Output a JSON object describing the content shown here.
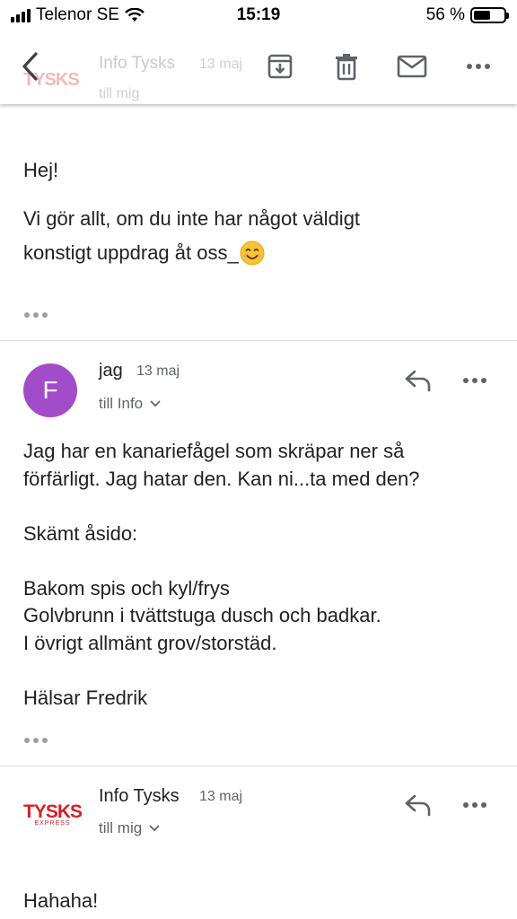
{
  "status_bar": {
    "carrier": "Telenor SE",
    "time": "15:19",
    "battery": "56 %",
    "battery_level": 0.56
  },
  "toolbar": {
    "ghost_sender": "Info Tysks",
    "ghost_date": "13 maj",
    "ghost_recipient": "till mig",
    "ghost_logo": "TYSKS",
    "icons": [
      "back-icon",
      "archive-icon",
      "delete-icon",
      "mail-icon",
      "more-icon"
    ]
  },
  "message1": {
    "greeting": "Hej!",
    "body_line1": "Vi gör allt, om du inte har något väldigt",
    "body_line2": "konstigt uppdrag åt oss_"
  },
  "message2": {
    "avatar_letter": "F",
    "avatar_color": "#a24cc9",
    "sender": "jag",
    "date": "13 maj",
    "recipient": "till Info",
    "lines": [
      "Jag har en kanariefågel som skräpar ner så",
      "förfärligt. Jag hatar den. Kan ni...ta med den?",
      "",
      "Skämt åsido:",
      "",
      "Bakom spis och kyl/frys",
      "Golvbrunn i tvättstuga dusch och badkar.",
      "I övrigt allmänt grov/storstäd.",
      "",
      "Hälsar Fredrik"
    ]
  },
  "message3": {
    "logo_text": "TYSKS",
    "logo_sub": "EXPRESS",
    "logo_color": "#d61f26",
    "sender": "Info Tysks",
    "date": "13 maj",
    "recipient": "till mig",
    "body_first": "Hahaha!"
  }
}
